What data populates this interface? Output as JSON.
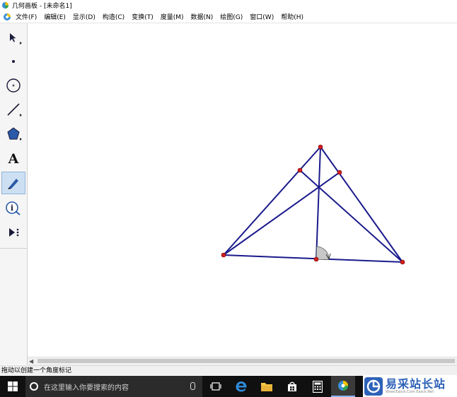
{
  "window": {
    "title": "几何画板 - [未命名1]"
  },
  "menu": [
    "文件(F)",
    "编辑(E)",
    "显示(D)",
    "构造(C)",
    "变换(T)",
    "度量(M)",
    "数据(N)",
    "绘图(G)",
    "窗口(W)",
    "帮助(H)"
  ],
  "toolbox": {
    "tools": [
      {
        "id": "arrow",
        "icon": "arrow-select-icon",
        "label": ""
      },
      {
        "id": "point",
        "icon": "point-tool-icon",
        "label": ""
      },
      {
        "id": "compass",
        "icon": "compass-tool-icon",
        "label": ""
      },
      {
        "id": "straightedge",
        "icon": "straightedge-tool-icon",
        "label": ""
      },
      {
        "id": "polygon",
        "icon": "polygon-tool-icon",
        "label": ""
      },
      {
        "id": "text",
        "icon": "text-tool-icon",
        "label": "A"
      },
      {
        "id": "marker",
        "icon": "marker-tool-icon",
        "label": "",
        "active": true
      },
      {
        "id": "info",
        "icon": "info-tool-icon",
        "label": "i"
      },
      {
        "id": "custom",
        "icon": "custom-tool-icon",
        "label": ""
      }
    ]
  },
  "status": {
    "text": "拖动以创建一个角度标记"
  },
  "taskbar": {
    "search_placeholder": "在这里输入你要搜索的内容",
    "icons": [
      "windows-start-icon",
      "task-view-icon",
      "edge-icon",
      "file-explorer-icon",
      "store-icon",
      "calculator-icon",
      "sketchpad-icon"
    ]
  },
  "watermark": {
    "name": "易采站长站",
    "url": "Www.Easck.Com  Easck.Net"
  },
  "colors": {
    "segment": "#1a1a8c",
    "point": "#d11f1f",
    "angle_mark": "#c8c8c8",
    "active_tool": "#cde0f3"
  }
}
